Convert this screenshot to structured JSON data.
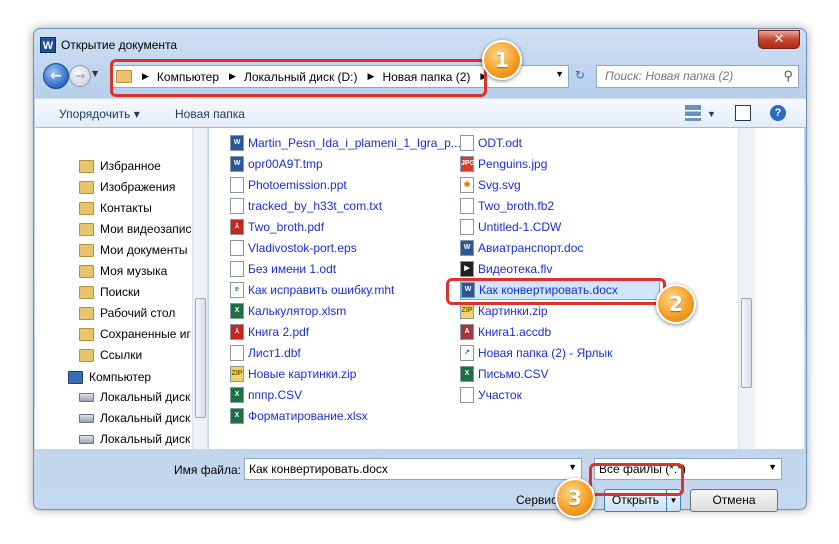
{
  "window": {
    "title": "Открытие документа",
    "app_icon": "W",
    "close_glyph": "✕"
  },
  "navbar": {
    "breadcrumb": [
      "Компьютер",
      "Локальный диск (D:)",
      "Новая папка (2)"
    ],
    "search_placeholder": "Поиск: Новая папка (2)"
  },
  "toolbar": {
    "organize": "Упорядочить ▾",
    "new_folder": "Новая папка"
  },
  "nav_pane": {
    "items": [
      {
        "label": "Избранное",
        "icon": "folder"
      },
      {
        "label": "Изображения",
        "icon": "folder"
      },
      {
        "label": "Контакты",
        "icon": "folder"
      },
      {
        "label": "Мои видеозапис",
        "icon": "folder"
      },
      {
        "label": "Мои документы",
        "icon": "folder"
      },
      {
        "label": "Моя музыка",
        "icon": "folder"
      },
      {
        "label": "Поиски",
        "icon": "folder"
      },
      {
        "label": "Рабочий стол",
        "icon": "folder"
      },
      {
        "label": "Сохраненные иг",
        "icon": "folder"
      },
      {
        "label": "Ссылки",
        "icon": "folder"
      },
      {
        "label": "Компьютер",
        "icon": "computer"
      },
      {
        "label": "Локальный диск",
        "icon": "drive"
      },
      {
        "label": "Локальный диск",
        "icon": "drive"
      },
      {
        "label": "Локальный диск",
        "icon": "drive"
      }
    ]
  },
  "files": {
    "col1": [
      "Martin_Pesn_Ida_i_plameni_1_Igra_p...",
      "opr00A9T.tmp",
      "Photoemission.ppt",
      "tracked_by_h33t_com.txt",
      "Two_broth.pdf",
      "Vladivostok-port.eps",
      "Без имени 1.odt",
      "Как исправить ошибку.mht",
      "Калькулятор.xlsm",
      "Книга 2.pdf",
      "Лист1.dbf",
      "Новые картинки.zip",
      "пппр.CSV",
      "Форматирование.xlsx"
    ],
    "col2": [
      "ODT.odt",
      "Penguins.jpg",
      "Svg.svg",
      "Two_broth.fb2",
      "Untitled-1.CDW",
      "Авиатранспорт.doc",
      "Видеотека.flv",
      "Как конвертировать.docx",
      "Картинки.zip",
      "Книга1.accdb",
      "Новая папка (2) - Ярлык",
      "Письмо.CSV",
      "Участок"
    ],
    "col1_icons": [
      "word",
      "word",
      "doc",
      "doc",
      "pdf",
      "eps",
      "odt",
      "mht",
      "excel",
      "pdf",
      "doc",
      "zip",
      "excel",
      "excel"
    ],
    "col2_icons": [
      "odt",
      "jpg",
      "svg",
      "doc",
      "doc",
      "word",
      "flv",
      "word",
      "zip",
      "access",
      "link",
      "excel",
      "doc"
    ],
    "selected": "Как конвертировать.docx"
  },
  "bottom": {
    "filename_label": "Имя файла:",
    "filename_value": "Как конвертировать.docx",
    "filter_value": "Все файлы (*.*)",
    "service_label": "Сервис",
    "open_label": "Открыть",
    "cancel_label": "Отмена"
  },
  "annotations": {
    "badge1": "1",
    "badge2": "2",
    "badge3": "3",
    "accent": "#d9342b",
    "badge_color": "#f39a1d"
  }
}
